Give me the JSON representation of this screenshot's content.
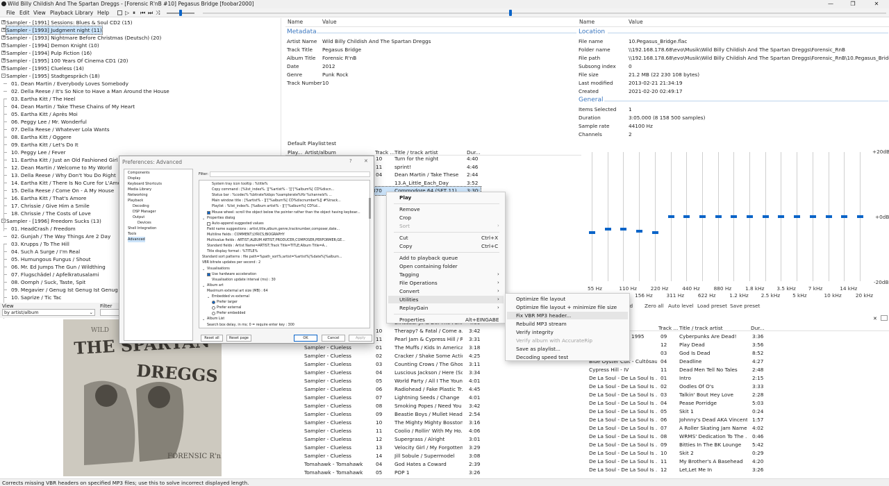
{
  "window": {
    "title": "Wild Billy Childish And The Spartan Dreggs - [Forensic R'nB #10] Pegasus Bridge  [foobar2000]",
    "controls": [
      "—",
      "❐",
      "✕"
    ]
  },
  "menu": [
    "File",
    "Edit",
    "View",
    "Playback",
    "Library",
    "Help"
  ],
  "seekbar_position": 0.45,
  "volume_level": 0.5,
  "tree": [
    {
      "label": "Sampler - [1991] Sessions: Blues & Soul CD2 (15)",
      "node": "+"
    },
    {
      "label": "Sampler - [1993] Judgment night (11)",
      "node": "+",
      "selected": true
    },
    {
      "label": "Sampler - [1993] Nightmare Before Christmas (Deutsch) (20)",
      "node": "+"
    },
    {
      "label": "Sampler - [1994] Demon Knight (10)",
      "node": "+"
    },
    {
      "label": "Sampler - [1994] Pulp Fiction (16)",
      "node": "+"
    },
    {
      "label": "Sampler - [1995] 100 Years Of Cinema CD1 (20)",
      "node": "+"
    },
    {
      "label": "Sampler - [1995] Clueless (14)",
      "node": "+"
    },
    {
      "label": "Sampler - [1995] Stadtgespräch (18)",
      "node": "-"
    },
    {
      "label": "01. Dean Martin / Everybody Loves Somebody",
      "indent": 1
    },
    {
      "label": "02. Della Reese / It's So Nice to Have a Man Around the House",
      "indent": 1
    },
    {
      "label": "03. Eartha Kitt / The Heel",
      "indent": 1
    },
    {
      "label": "04. Dean Martin / Take These Chains of My Heart",
      "indent": 1
    },
    {
      "label": "05. Eartha Kitt / Après Moi",
      "indent": 1
    },
    {
      "label": "06. Peggy Lee / Mr. Wonderful",
      "indent": 1
    },
    {
      "label": "07. Della Reese / Whatever Lola Wants",
      "indent": 1
    },
    {
      "label": "08. Eartha Kitt / Oggere",
      "indent": 1
    },
    {
      "label": "09. Eartha Kitt / Let's Do It",
      "indent": 1
    },
    {
      "label": "10. Peggy Lee / Fever",
      "indent": 1
    },
    {
      "label": "11. Eartha Kitt / Just an Old Fashioned Girl",
      "indent": 1
    },
    {
      "label": "12. Dean Martin / Welcome to My World",
      "indent": 1
    },
    {
      "label": "13. Della Reese / Why Don't You Do Right",
      "indent": 1
    },
    {
      "label": "14. Eartha Kitt / There Is No Cure for L'Amour",
      "indent": 1
    },
    {
      "label": "15. Della Reese / Come On - A My House",
      "indent": 1
    },
    {
      "label": "16. Eartha Kitt / That's Amore",
      "indent": 1
    },
    {
      "label": "17. Chrissie / Give Him a Smile",
      "indent": 1
    },
    {
      "label": "18. Chrissie / The Costs of Love",
      "indent": 1
    },
    {
      "label": "Sampler - [1996] Freedom Sucks (13)",
      "node": "-"
    },
    {
      "label": "01. HeadCrash / Freedom",
      "indent": 1
    },
    {
      "label": "02. Gunjah / The Way Things Are 2 Day",
      "indent": 1
    },
    {
      "label": "03. Krupps / To The Hill",
      "indent": 1
    },
    {
      "label": "04. Such A Surge / I'm Real",
      "indent": 1
    },
    {
      "label": "05. Humungous Fungus / Shout",
      "indent": 1
    },
    {
      "label": "06. Mr. Ed Jumps The Gun / Wildthing",
      "indent": 1
    },
    {
      "label": "07. Flugschädel / Apfelkratusalami",
      "indent": 1
    },
    {
      "label": "08. Oomph / Suck, Taste, Spit",
      "indent": 1
    },
    {
      "label": "09. Megavier / Genug Ist Genug Ist Genug",
      "indent": 1
    },
    {
      "label": "10. Saprize / Tic Tac",
      "indent": 1
    }
  ],
  "viewbar": {
    "view_label": "View",
    "view_value": "by artist/album",
    "filter_label": "Filter"
  },
  "album_art": {
    "line1": "THE SPARTAN",
    "line2": "DREGGS",
    "corner": "FORENSIC R'nB"
  },
  "properties_left": {
    "col_name": "Name",
    "col_value": "Value",
    "section": "Metadata",
    "rows": [
      {
        "k": "Artist Name",
        "v": "Wild Billy Childish And The Spartan Dreggs"
      },
      {
        "k": "Track Title",
        "v": "Pegasus Bridge"
      },
      {
        "k": "Album Title",
        "v": "Forensic R'nB"
      },
      {
        "k": "Date",
        "v": "2012"
      },
      {
        "k": "Genre",
        "v": "Punk Rock"
      },
      {
        "k": "Track Number",
        "v": "10"
      }
    ]
  },
  "properties_right": {
    "col_name": "Name",
    "col_value": "Value",
    "location_section": "Location",
    "location": [
      {
        "k": "File name",
        "v": "10.Pegasus_Bridge.flac"
      },
      {
        "k": "Folder name",
        "v": "\\\\192.168.178.68\\evo\\Musik\\Wild Billy Childish And The Spartan Dreggs\\Forensic_RnB"
      },
      {
        "k": "File path",
        "v": "\\\\192.168.178.68\\evo\\Musik\\Wild Billy Childish And The Spartan Dreggs\\Forensic_RnB\\10.Pegasus_Bridge.flac"
      },
      {
        "k": "Subsong index",
        "v": "0"
      },
      {
        "k": "File size",
        "v": "21.2 MB (22 230 108 bytes)"
      },
      {
        "k": "Last modified",
        "v": "2013-02-21 21:34:19"
      },
      {
        "k": "Created",
        "v": "2021-02-20 02:49:17"
      }
    ],
    "general_section": "General",
    "general": [
      {
        "k": "Items Selected",
        "v": "1"
      },
      {
        "k": "Duration",
        "v": "3:05.000 (8 158 500 samples)"
      },
      {
        "k": "Sample rate",
        "v": "44100 Hz"
      },
      {
        "k": "Channels",
        "v": "2"
      }
    ]
  },
  "playlist": {
    "tabs": [
      "Default Playlist",
      "test"
    ],
    "headers": [
      "Play...",
      "Artist/album",
      "Track ...",
      "Title / track artist",
      "Dur..."
    ],
    "top_rows": [
      {
        "track": "10",
        "title": "Turn for the night",
        "dur": "4:40"
      },
      {
        "track": "11",
        "title": "sprint!",
        "dur": "4:46"
      },
      {
        "track": "04",
        "title": "Dean Martin / Take These C...",
        "dur": "2:44"
      },
      {
        "track": "",
        "title": "13.A_Little_Each_Day",
        "dur": "3:52"
      },
      {
        "track": "370",
        "title": "Commodore 64 (SET 11)",
        "dur": "3:30:",
        "selected": true
      }
    ],
    "bottom_rows": [
      {
        "artist": "",
        "track": "",
        "title": "Dinosaur Jr. & Del The Funk...",
        "dur": "4:00"
      },
      {
        "artist": "",
        "track": "10",
        "title": "Therapy? & Fatal / Come a...",
        "dur": "3:42"
      },
      {
        "artist": "",
        "track": "11",
        "title": "Pearl Jam & Cypress Hill / R...",
        "dur": "3:31"
      },
      {
        "artist": "Sampler - Clueless",
        "track": "01",
        "title": "The Muffs / Kids In America",
        "dur": "3:18"
      },
      {
        "artist": "Sampler - Clueless",
        "track": "02",
        "title": "Cracker / Shake Some Action",
        "dur": "4:25"
      },
      {
        "artist": "Sampler - Clueless",
        "track": "03",
        "title": "Counting Crows / The Ghos...",
        "dur": "3:11"
      },
      {
        "artist": "Sampler - Clueless",
        "track": "04",
        "title": "Luscious Jackson / Here (Sq...",
        "dur": "3:34"
      },
      {
        "artist": "Sampler - Clueless",
        "track": "05",
        "title": "World Party / All I The Youn...",
        "dur": "4:01"
      },
      {
        "artist": "Sampler - Clueless",
        "track": "06",
        "title": "Radiohead / Fake Plastic Tr...",
        "dur": "4:45"
      },
      {
        "artist": "Sampler - Clueless",
        "track": "07",
        "title": "Lightning Seeds / Change",
        "dur": "4:01"
      },
      {
        "artist": "Sampler - Clueless",
        "track": "08",
        "title": "Smoking Popes / Need You ...",
        "dur": "3:42"
      },
      {
        "artist": "Sampler - Clueless",
        "track": "09",
        "title": "Beastie Boys / Mullet Head",
        "dur": "2:54"
      },
      {
        "artist": "Sampler - Clueless",
        "track": "10",
        "title": "The Mighty Mighty Bosston...",
        "dur": "3:16"
      },
      {
        "artist": "Sampler - Clueless",
        "track": "11",
        "title": "Coolio / Rollin' With My Ho...",
        "dur": "4:06"
      },
      {
        "artist": "Sampler - Clueless",
        "track": "12",
        "title": "Supergrass / Alright",
        "dur": "3:01"
      },
      {
        "artist": "Sampler - Clueless",
        "track": "13",
        "title": "Velocity Girl / My Forgotten...",
        "dur": "3:29"
      },
      {
        "artist": "Sampler - Clueless",
        "track": "14",
        "title": "Jill Sobule / Supermodel",
        "dur": "3:08"
      },
      {
        "artist": "Tomahawk - Tomahawk",
        "track": "04",
        "title": "God Hates a Coward",
        "dur": "2:39"
      },
      {
        "artist": "Tomahawk - Tomahawk",
        "track": "05",
        "title": "POP 1",
        "dur": "3:26"
      }
    ]
  },
  "equalizer": {
    "scale": [
      "+20dB",
      "+0dB",
      "-20dB"
    ],
    "bands": [
      "55 Hz",
      "77 Hz",
      "110 Hz",
      "156 Hz",
      "220 Hz",
      "311 Hz",
      "440 Hz",
      "622 Hz",
      "880 Hz",
      "1.2 kHz",
      "1.8 kHz",
      "2.5 kHz",
      "3.5 kHz",
      "5 kHz",
      "7 kHz",
      "10 kHz",
      "14 kHz",
      "20 kHz"
    ],
    "gains_db": [
      -5,
      -4,
      -4,
      -4.5,
      -5,
      0,
      0,
      0,
      0,
      0,
      0,
      0,
      0,
      0,
      0,
      0,
      0,
      0
    ],
    "buttons": [
      "led",
      "Zero all",
      "Auto level",
      "Load preset",
      "Save preset"
    ]
  },
  "prefs": {
    "title": "Preferences: Advanced",
    "help": "?",
    "close": "✕",
    "filter_label": "Filter:",
    "nav": [
      {
        "label": "Components",
        "indent": 0
      },
      {
        "label": "Display",
        "indent": 0
      },
      {
        "label": "Keyboard Shortcuts",
        "indent": 0
      },
      {
        "label": "Media Library",
        "indent": 0
      },
      {
        "label": "Networking",
        "indent": 0
      },
      {
        "label": "Playback",
        "indent": 0
      },
      {
        "label": "Decoding",
        "indent": 1
      },
      {
        "label": "DSP Manager",
        "indent": 1
      },
      {
        "label": "Output",
        "indent": 1
      },
      {
        "label": "Devices",
        "indent": 2
      },
      {
        "label": "Shell Integration",
        "indent": 0
      },
      {
        "label": "Tools",
        "indent": 0
      },
      {
        "label": "Advanced",
        "indent": 0,
        "selected": true
      }
    ],
    "adv": [
      {
        "label": "System tray icon tooltip : %title%",
        "indent": 2
      },
      {
        "label": "Copy command : [%list_index%. ]['%artist% - ']['['%album%[ CD%discn...",
        "indent": 2
      },
      {
        "label": "Status bar : %codec% %bitrate%kbps %samplerate%Hz %channels% ...",
        "indent": 2
      },
      {
        "label": "Main window title : [%artist% - ]['['%album%[ CD%discnumber%][ #%track...",
        "indent": 2
      },
      {
        "label": "Playlist : %list_index%. [%album artist% - ]['['%album%[ CD%d...",
        "indent": 2
      },
      {
        "label": "Mouse wheel: scroll the object below the pointer rather than the object having keyboar...",
        "indent": 1,
        "check": true
      },
      {
        "label": "Properties dialog",
        "indent": 0,
        "node": "-"
      },
      {
        "label": "Auto-append suggested values",
        "indent": 1,
        "check": false
      },
      {
        "label": "Field name suggestions : artist,title,album,genre,tracknumber,composer,date...",
        "indent": 1
      },
      {
        "label": "Multiline fields : COMMENT;LYRICS;BIOGRAPHY",
        "indent": 1
      },
      {
        "label": "Multivalue fields : ARTIST;ALBUM ARTIST;PRODUCER;COMPOSER;PERFORMER;GE...",
        "indent": 1
      },
      {
        "label": "Standard fields : Artist Name=ARTIST;Track Title=TITLE;Album Title=A...",
        "indent": 1
      },
      {
        "label": "Title display format : %TITLE%",
        "indent": 1
      },
      {
        "label": "Standard sort patterns : file path=%path_sort%;artist=%artist%|%date%|%album...",
        "indent": 0
      },
      {
        "label": "VBR bitrate updates per second : 2",
        "indent": 0
      },
      {
        "label": "Visualisations",
        "indent": 0,
        "node": "-"
      },
      {
        "label": "Use hardware acceleration",
        "indent": 1,
        "check": true
      },
      {
        "label": "Visualisation update interval (ms) : 30",
        "indent": 2
      },
      {
        "label": "Album art",
        "indent": 0,
        "node": "-"
      },
      {
        "label": "Maximum external art size (MB) : 64",
        "indent": 1
      },
      {
        "label": "Embedded vs external",
        "indent": 1,
        "node": "-"
      },
      {
        "label": "Prefer larger",
        "indent": 2,
        "radio": true
      },
      {
        "label": "Prefer external",
        "indent": 2,
        "radio": false
      },
      {
        "label": "Prefer embedded",
        "indent": 2,
        "radio": false
      },
      {
        "label": "Album List",
        "indent": 0,
        "node": "-"
      },
      {
        "label": "Search box delay, in ms; 0 = require enter key : 300",
        "indent": 1
      }
    ],
    "buttons": {
      "reset_all": "Reset all",
      "reset_page": "Reset page",
      "ok": "OK",
      "cancel": "Cancel",
      "apply": "Apply"
    }
  },
  "context_menu": {
    "items": [
      {
        "label": "Play",
        "bold": true
      },
      {
        "sep": true
      },
      {
        "label": "Remove"
      },
      {
        "label": "Crop"
      },
      {
        "label": "Sort",
        "disabled": true,
        "arrow": true
      },
      {
        "sep": true
      },
      {
        "label": "Cut",
        "shortcut": "Ctrl+X"
      },
      {
        "label": "Copy",
        "shortcut": "Ctrl+C"
      },
      {
        "sep": true
      },
      {
        "label": "Add to playback queue"
      },
      {
        "label": "Open containing folder"
      },
      {
        "label": "Tagging",
        "arrow": true
      },
      {
        "label": "File Operations",
        "arrow": true
      },
      {
        "label": "Convert",
        "arrow": true
      },
      {
        "label": "Utilities",
        "arrow": true,
        "highlight": true
      },
      {
        "label": "ReplayGain",
        "arrow": true
      },
      {
        "sep": true
      },
      {
        "label": "Properties",
        "shortcut": "Alt+EINGABE"
      }
    ],
    "submenu": [
      {
        "label": "Optimize file layout"
      },
      {
        "label": "Optimize file layout + minimize file size"
      },
      {
        "label": "Fix VBR MP3 header...",
        "highlight": true
      },
      {
        "label": "Rebuild MP3 stream"
      },
      {
        "label": "Verify integrity"
      },
      {
        "label": "Verify album with AccurateRip",
        "disabled": true
      },
      {
        "label": "Save as playlist..."
      },
      {
        "label": "Decoding speed test"
      }
    ]
  },
  "right_list": {
    "headers": [
      "",
      "Track ...",
      "Title / track artist",
      "Dur..."
    ],
    "close_glyph": "✕",
    "rows": [
      {
        "artist": "- 1995",
        "track": "09",
        "title": "Cyberpunks Are Dead!",
        "dur": "3:36"
      },
      {
        "artist": "",
        "track": "12",
        "title": "Play Dead",
        "dur": "3:56"
      },
      {
        "artist": "",
        "track": "03",
        "title": "God Is Dead",
        "dur": "8:52"
      },
      {
        "artist": "Blue Öyster Cult - Cultösaur...",
        "track": "04",
        "title": "Deadline",
        "dur": "4:27"
      },
      {
        "artist": "Cypress Hill - IV",
        "track": "11",
        "title": "Dead Men Tell No Tales",
        "dur": "2:48"
      },
      {
        "artist": "De La Soul - De La Soul Is ...",
        "track": "01",
        "title": "Intro",
        "dur": "2:15"
      },
      {
        "artist": "De La Soul - De La Soul Is ...",
        "track": "02",
        "title": "Oodles Of O's",
        "dur": "3:33"
      },
      {
        "artist": "De La Soul - De La Soul Is ...",
        "track": "03",
        "title": "Talkin' Bout Hey Love",
        "dur": "2:28"
      },
      {
        "artist": "De La Soul - De La Soul Is ...",
        "track": "04",
        "title": "Pease Porridge",
        "dur": "5:03"
      },
      {
        "artist": "De La Soul - De La Soul Is ...",
        "track": "05",
        "title": "Skit 1",
        "dur": "0:24"
      },
      {
        "artist": "De La Soul - De La Soul Is ...",
        "track": "06",
        "title": "Johnny's Dead AKA Vincent...",
        "dur": "1:57"
      },
      {
        "artist": "De La Soul - De La Soul Is ...",
        "track": "07",
        "title": "A Roller Skating Jam Name...",
        "dur": "4:02"
      },
      {
        "artist": "De La Soul - De La Soul Is ...",
        "track": "08",
        "title": "WRMS' Dedication To The ...",
        "dur": "0:46"
      },
      {
        "artist": "De La Soul - De La Soul Is ...",
        "track": "09",
        "title": "Bitties In The BK Lounge",
        "dur": "5:42"
      },
      {
        "artist": "De La Soul - De La Soul Is ...",
        "track": "10",
        "title": "Skit 2",
        "dur": "0:29"
      },
      {
        "artist": "De La Soul - De La Soul Is ...",
        "track": "11",
        "title": "My Brother's A Basehead",
        "dur": "4:20"
      },
      {
        "artist": "De La Soul - De La Soul Is ...",
        "track": "12",
        "title": "Let,Let Me In",
        "dur": "3:26"
      }
    ]
  },
  "status": "Corrects missing VBR headers on specified MP3 files; use this to solve incorrect displayed length."
}
